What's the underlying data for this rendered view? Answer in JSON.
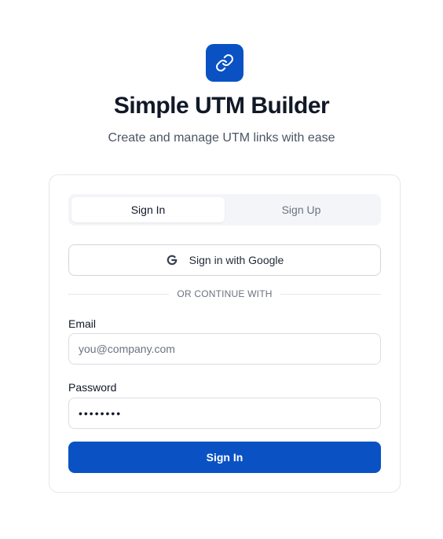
{
  "app": {
    "icon": "link-icon",
    "title": "Simple UTM Builder",
    "subtitle": "Create and manage UTM links with ease",
    "brand_color": "#0a52c4"
  },
  "auth": {
    "tabs": [
      {
        "label": "Sign In",
        "active": true
      },
      {
        "label": "Sign Up",
        "active": false
      }
    ],
    "google_button": {
      "label": "Sign in with Google",
      "icon": "google-icon"
    },
    "divider_text": "OR CONTINUE WITH",
    "email": {
      "label": "Email",
      "placeholder": "you@company.com",
      "value": ""
    },
    "password": {
      "label": "Password",
      "value": "••••••••"
    },
    "submit_label": "Sign In"
  }
}
